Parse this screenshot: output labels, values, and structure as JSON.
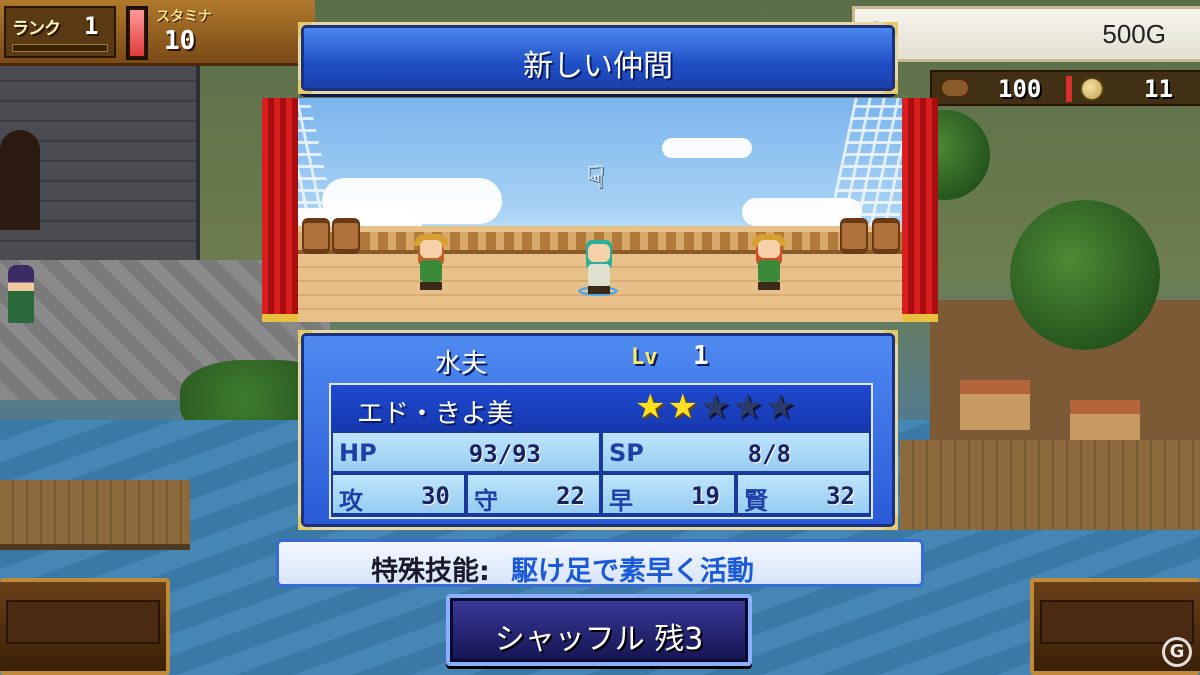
{
  "hud": {
    "rank_label": "ランク",
    "rank_value": "1",
    "stamina_label": "スタミナ",
    "stamina_value": "10",
    "gold_value": "500G",
    "wood_value": "100",
    "medal_value": "11"
  },
  "dialog": {
    "title": "新しい仲間"
  },
  "character": {
    "job": "水夫",
    "lv_label": "Lv",
    "lv_value": "1",
    "name": "エド・きよ美",
    "stars_filled": 2,
    "stars_total": 5,
    "stats": {
      "hp_label": "HP",
      "hp_value": "93/93",
      "sp_label": "SP",
      "sp_value": "8/8",
      "atk_label": "攻",
      "atk_value": "30",
      "def_label": "守",
      "def_value": "22",
      "spd_label": "早",
      "spd_value": "19",
      "int_label": "賢",
      "int_value": "32"
    },
    "skill_label": "特殊技能:",
    "skill_value": "駆け足で素早く活動"
  },
  "buttons": {
    "shuffle": "シャッフル 残3"
  },
  "colors": {
    "panel_blue": "#2a5ad8",
    "star_on": "#ffe020",
    "curtain_red": "#d81e1e"
  }
}
